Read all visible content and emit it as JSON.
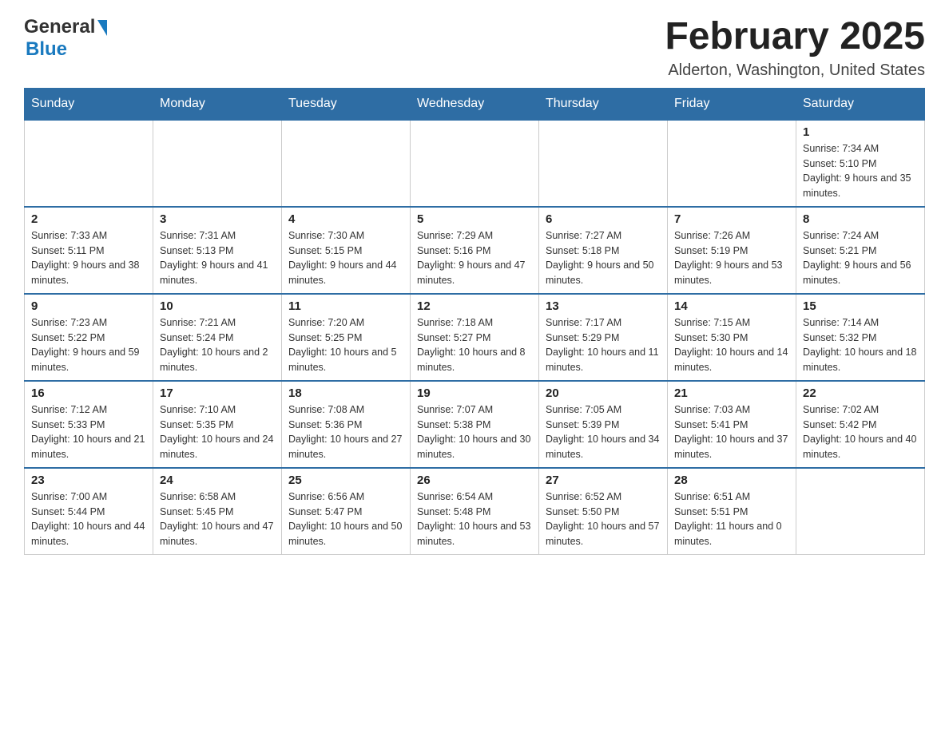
{
  "header": {
    "logo": {
      "general": "General",
      "blue": "Blue"
    },
    "title": "February 2025",
    "location": "Alderton, Washington, United States"
  },
  "calendar": {
    "days_of_week": [
      "Sunday",
      "Monday",
      "Tuesday",
      "Wednesday",
      "Thursday",
      "Friday",
      "Saturday"
    ],
    "weeks": [
      [
        {
          "day": "",
          "info": ""
        },
        {
          "day": "",
          "info": ""
        },
        {
          "day": "",
          "info": ""
        },
        {
          "day": "",
          "info": ""
        },
        {
          "day": "",
          "info": ""
        },
        {
          "day": "",
          "info": ""
        },
        {
          "day": "1",
          "info": "Sunrise: 7:34 AM\nSunset: 5:10 PM\nDaylight: 9 hours and 35 minutes."
        }
      ],
      [
        {
          "day": "2",
          "info": "Sunrise: 7:33 AM\nSunset: 5:11 PM\nDaylight: 9 hours and 38 minutes."
        },
        {
          "day": "3",
          "info": "Sunrise: 7:31 AM\nSunset: 5:13 PM\nDaylight: 9 hours and 41 minutes."
        },
        {
          "day": "4",
          "info": "Sunrise: 7:30 AM\nSunset: 5:15 PM\nDaylight: 9 hours and 44 minutes."
        },
        {
          "day": "5",
          "info": "Sunrise: 7:29 AM\nSunset: 5:16 PM\nDaylight: 9 hours and 47 minutes."
        },
        {
          "day": "6",
          "info": "Sunrise: 7:27 AM\nSunset: 5:18 PM\nDaylight: 9 hours and 50 minutes."
        },
        {
          "day": "7",
          "info": "Sunrise: 7:26 AM\nSunset: 5:19 PM\nDaylight: 9 hours and 53 minutes."
        },
        {
          "day": "8",
          "info": "Sunrise: 7:24 AM\nSunset: 5:21 PM\nDaylight: 9 hours and 56 minutes."
        }
      ],
      [
        {
          "day": "9",
          "info": "Sunrise: 7:23 AM\nSunset: 5:22 PM\nDaylight: 9 hours and 59 minutes."
        },
        {
          "day": "10",
          "info": "Sunrise: 7:21 AM\nSunset: 5:24 PM\nDaylight: 10 hours and 2 minutes."
        },
        {
          "day": "11",
          "info": "Sunrise: 7:20 AM\nSunset: 5:25 PM\nDaylight: 10 hours and 5 minutes."
        },
        {
          "day": "12",
          "info": "Sunrise: 7:18 AM\nSunset: 5:27 PM\nDaylight: 10 hours and 8 minutes."
        },
        {
          "day": "13",
          "info": "Sunrise: 7:17 AM\nSunset: 5:29 PM\nDaylight: 10 hours and 11 minutes."
        },
        {
          "day": "14",
          "info": "Sunrise: 7:15 AM\nSunset: 5:30 PM\nDaylight: 10 hours and 14 minutes."
        },
        {
          "day": "15",
          "info": "Sunrise: 7:14 AM\nSunset: 5:32 PM\nDaylight: 10 hours and 18 minutes."
        }
      ],
      [
        {
          "day": "16",
          "info": "Sunrise: 7:12 AM\nSunset: 5:33 PM\nDaylight: 10 hours and 21 minutes."
        },
        {
          "day": "17",
          "info": "Sunrise: 7:10 AM\nSunset: 5:35 PM\nDaylight: 10 hours and 24 minutes."
        },
        {
          "day": "18",
          "info": "Sunrise: 7:08 AM\nSunset: 5:36 PM\nDaylight: 10 hours and 27 minutes."
        },
        {
          "day": "19",
          "info": "Sunrise: 7:07 AM\nSunset: 5:38 PM\nDaylight: 10 hours and 30 minutes."
        },
        {
          "day": "20",
          "info": "Sunrise: 7:05 AM\nSunset: 5:39 PM\nDaylight: 10 hours and 34 minutes."
        },
        {
          "day": "21",
          "info": "Sunrise: 7:03 AM\nSunset: 5:41 PM\nDaylight: 10 hours and 37 minutes."
        },
        {
          "day": "22",
          "info": "Sunrise: 7:02 AM\nSunset: 5:42 PM\nDaylight: 10 hours and 40 minutes."
        }
      ],
      [
        {
          "day": "23",
          "info": "Sunrise: 7:00 AM\nSunset: 5:44 PM\nDaylight: 10 hours and 44 minutes."
        },
        {
          "day": "24",
          "info": "Sunrise: 6:58 AM\nSunset: 5:45 PM\nDaylight: 10 hours and 47 minutes."
        },
        {
          "day": "25",
          "info": "Sunrise: 6:56 AM\nSunset: 5:47 PM\nDaylight: 10 hours and 50 minutes."
        },
        {
          "day": "26",
          "info": "Sunrise: 6:54 AM\nSunset: 5:48 PM\nDaylight: 10 hours and 53 minutes."
        },
        {
          "day": "27",
          "info": "Sunrise: 6:52 AM\nSunset: 5:50 PM\nDaylight: 10 hours and 57 minutes."
        },
        {
          "day": "28",
          "info": "Sunrise: 6:51 AM\nSunset: 5:51 PM\nDaylight: 11 hours and 0 minutes."
        },
        {
          "day": "",
          "info": ""
        }
      ]
    ]
  }
}
